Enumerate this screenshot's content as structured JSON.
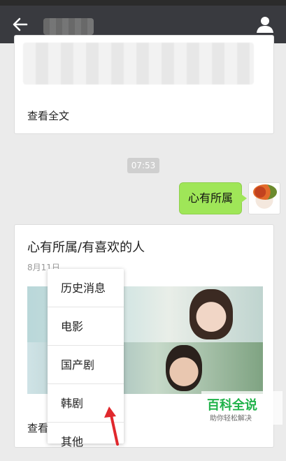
{
  "menu": {
    "items": [
      "历史消息",
      "电影",
      "国产剧",
      "韩剧",
      "其他"
    ]
  },
  "chat": {
    "read_full_1": "查看全文",
    "time": "07:53",
    "sent_message": "心有所属",
    "article_title": "心有所属/有喜欢的人",
    "article_date": "8月11日",
    "read_full_2": "查看"
  },
  "watermark": {
    "title": "百科全说",
    "subtitle": "助你轻松解决"
  },
  "colors": {
    "topbar": "#393a3f",
    "bubble": "#9fe658",
    "watermark_green": "#20b24a",
    "arrow_red": "#e0282d"
  },
  "icons": {
    "back": "back-arrow-icon",
    "user": "user-icon"
  }
}
